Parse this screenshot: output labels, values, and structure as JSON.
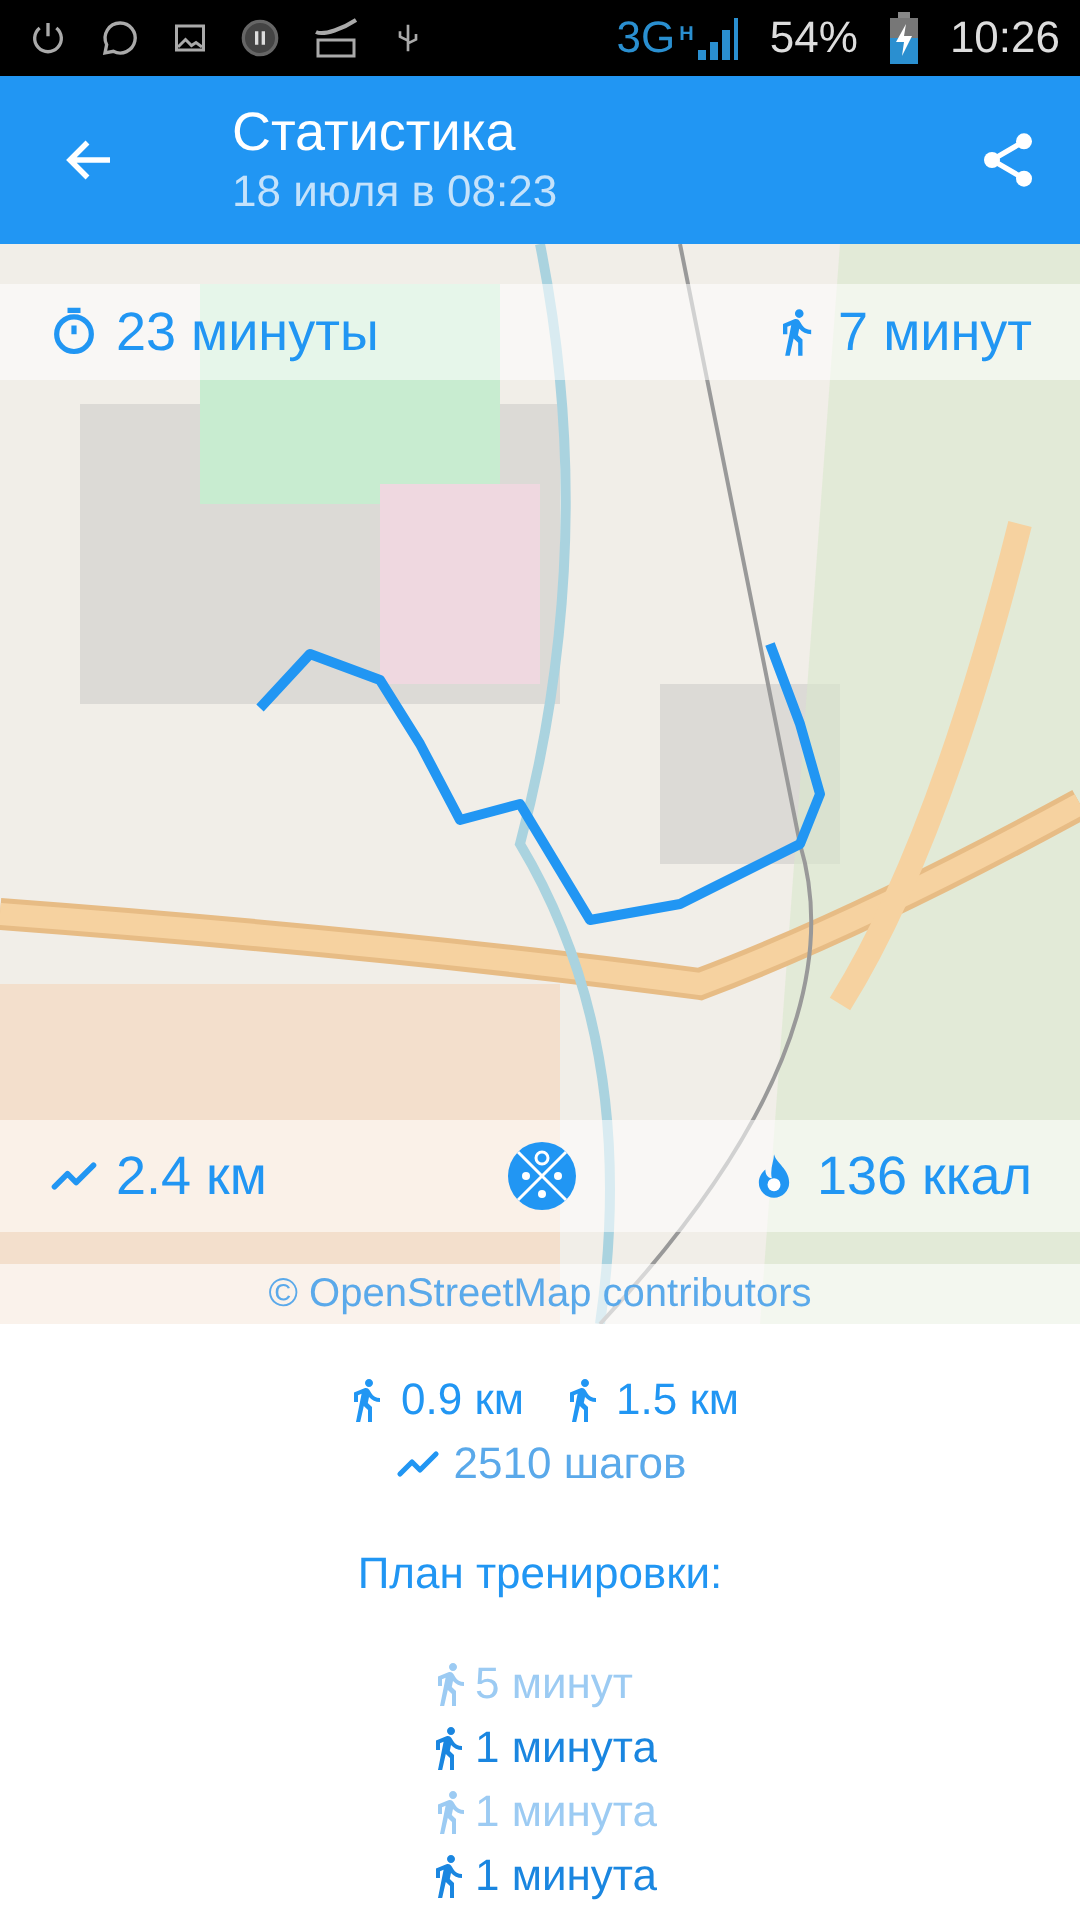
{
  "status_bar": {
    "network": "3G",
    "network_sub": "H",
    "battery": "54%",
    "time": "10:26"
  },
  "app_bar": {
    "title": "Статистика",
    "subtitle": "18 июля в 08:23"
  },
  "map": {
    "duration": "23 минуты",
    "run_time": "7 минут",
    "distance": "2.4 км",
    "calories": "136 ккал",
    "attribution": "© OpenStreetMap contributors"
  },
  "summary": {
    "run_distance": "0.9 км",
    "walk_distance": "1.5 км",
    "steps": "2510 шагов"
  },
  "plan": {
    "title": "План тренировки:",
    "items": [
      {
        "kind": "walk",
        "text": "5 минут"
      },
      {
        "kind": "run",
        "text": "1 минута"
      },
      {
        "kind": "walk",
        "text": "1 минута"
      },
      {
        "kind": "run",
        "text": "1 минута"
      }
    ]
  }
}
